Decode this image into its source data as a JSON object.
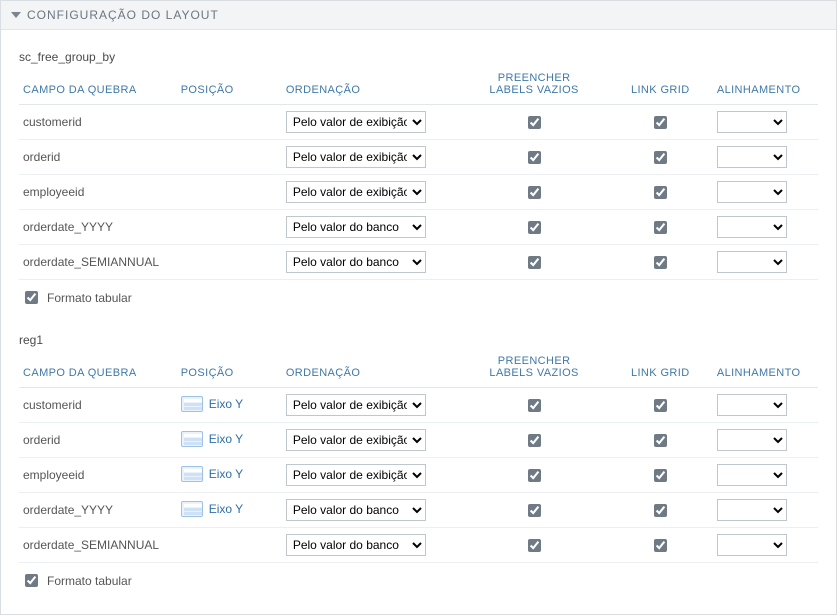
{
  "panel": {
    "title": "CONFIGURAÇÃO DO LAYOUT"
  },
  "columns": {
    "campo": "CAMPO DA QUEBRA",
    "posicao": "POSIÇÃO",
    "ordenacao": "ORDENAÇÃO",
    "preencher": "PREENCHER LABELS VAZIOS",
    "linkgrid": "LINK GRID",
    "alinhamento": "ALINHAMENTO"
  },
  "ord_options": {
    "exibicao": "Pelo valor de exibição",
    "banco": "Pelo valor do banco"
  },
  "eixo_label": "Eixo Y",
  "formato_label": "Formato tabular",
  "groups": [
    {
      "name": "sc_free_group_by",
      "show_pos": false,
      "rows": [
        {
          "campo": "customerid",
          "ord": "exibicao",
          "fill": true,
          "link": true
        },
        {
          "campo": "orderid",
          "ord": "exibicao",
          "fill": true,
          "link": true
        },
        {
          "campo": "employeeid",
          "ord": "exibicao",
          "fill": true,
          "link": true
        },
        {
          "campo": "orderdate_YYYY",
          "ord": "banco",
          "fill": true,
          "link": true
        },
        {
          "campo": "orderdate_SEMIANNUAL",
          "ord": "banco",
          "fill": true,
          "link": true
        }
      ],
      "formato_tabular": true
    },
    {
      "name": "reg1",
      "show_pos": true,
      "rows": [
        {
          "campo": "customerid",
          "ord": "exibicao",
          "fill": true,
          "link": true,
          "pos": true
        },
        {
          "campo": "orderid",
          "ord": "exibicao",
          "fill": true,
          "link": true,
          "pos": true
        },
        {
          "campo": "employeeid",
          "ord": "exibicao",
          "fill": true,
          "link": true,
          "pos": true
        },
        {
          "campo": "orderdate_YYYY",
          "ord": "banco",
          "fill": true,
          "link": true,
          "pos": true
        },
        {
          "campo": "orderdate_SEMIANNUAL",
          "ord": "banco",
          "fill": true,
          "link": true,
          "pos": false
        }
      ],
      "formato_tabular": true
    }
  ]
}
